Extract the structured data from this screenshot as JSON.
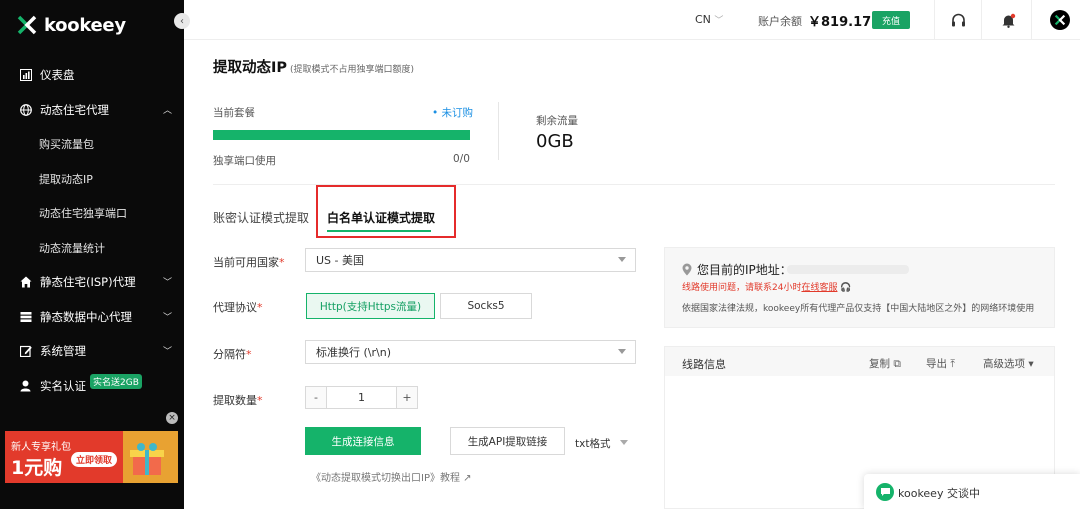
{
  "app": {
    "logo_text": "kookeey"
  },
  "sidebar": {
    "items": [
      {
        "label": "仪表盘",
        "icon": "dashboard-icon"
      },
      {
        "label": "动态住宅代理",
        "icon": "globe-icon",
        "expanded": true
      },
      {
        "label": "购买流量包"
      },
      {
        "label": "提取动态IP"
      },
      {
        "label": "动态住宅独享端口"
      },
      {
        "label": "动态流量统计"
      },
      {
        "label": "静态住宅(ISP)代理",
        "icon": "home-icon",
        "expanded": false
      },
      {
        "label": "静态数据中心代理",
        "icon": "server-icon",
        "expanded": false
      },
      {
        "label": "系统管理",
        "icon": "edit-icon",
        "expanded": false
      },
      {
        "label": "实名认证",
        "icon": "user-icon"
      }
    ],
    "bonus_badge": "实名送2GB",
    "promo": {
      "title": "新人专享礼包",
      "big": "1元购",
      "button": "立即领取"
    }
  },
  "topbar": {
    "lang": "CN",
    "balance_label": "账户余额",
    "balance_value": "￥819.17",
    "recharge": "充值"
  },
  "page": {
    "title": "提取动态IP",
    "subtitle": "(提取模式不占用独享端口额度)"
  },
  "plan": {
    "label": "当前套餐",
    "status": "• 未订购",
    "progress_fraction": 1.0,
    "port_label": "独享端口使用",
    "port_value": "0/0",
    "remaining_label": "剩余流量",
    "remaining_value": "0GB"
  },
  "tabs": [
    {
      "label": "账密认证模式提取",
      "active": false
    },
    {
      "label": "白名单认证模式提取",
      "active": true
    }
  ],
  "form": {
    "country_label": "当前可用国家",
    "country_value": "US - 美国",
    "protocol_label": "代理协议",
    "protocol_http": "Http(支持Https流量)",
    "protocol_socks": "Socks5",
    "separator_label": "分隔符",
    "separator_value": "标准换行 (\\r\\n)",
    "qty_label": "提取数量",
    "qty_minus": "-",
    "qty_value": "1",
    "qty_plus": "+",
    "generate": "生成连接信息",
    "api_button": "生成API提取链接",
    "format": "txt格式",
    "tutorial": "《动态提取模式切换出口IP》教程"
  },
  "ip_panel": {
    "title": "您目前的IP地址：",
    "warning_prefix": "线路使用问题，请联系24小时",
    "warning_link": "在线客服",
    "note": "依据国家法律法规，kookeey所有代理产品仅支持【中国大陆地区之外】的网络环境使用"
  },
  "route_panel": {
    "title": "线路信息",
    "copy": "复制",
    "export": "导出",
    "advanced": "高级选项"
  },
  "chat": {
    "label": "kookeey  交谈中"
  },
  "colors": {
    "brand_green": "#15b36a",
    "highlight_red": "#e52b2b",
    "link_blue": "#1a8fe3"
  }
}
